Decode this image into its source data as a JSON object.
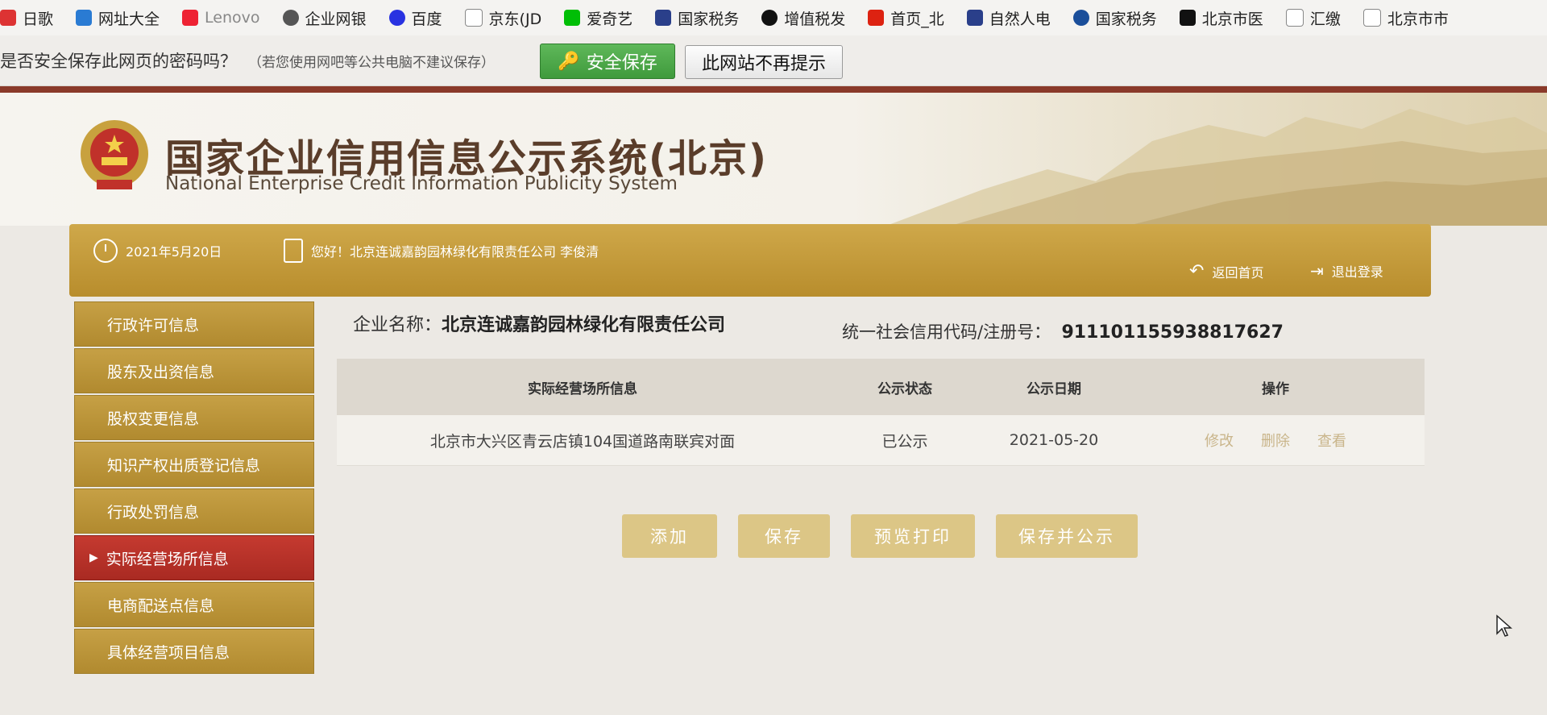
{
  "bookmarks": [
    "日歌",
    "网址大全",
    "Lenovo",
    "企业网银",
    "百度",
    "京东(JD",
    "爱奇艺",
    "国家税务",
    "增值税发",
    "首页_北",
    "自然人电",
    "国家税务",
    "北京市医",
    "汇缴",
    "北京市市"
  ],
  "infobar": {
    "message": "是否安全保存此网页的密码吗？",
    "note": "（若您使用网吧等公共电脑不建议保存）",
    "save_button": "安全保存",
    "never_button": "此网站不再提示"
  },
  "site": {
    "title": "国家企业信用信息公示系统(北京)",
    "subtitle": "National Enterprise Credit Information Publicity System"
  },
  "userbar": {
    "date": "2021年5月20日",
    "greeting": "您好！北京连诚嘉韵园林绿化有限责任公司  李俊清",
    "home": "返回首页",
    "logout": "退出登录"
  },
  "sidebar": {
    "items": [
      {
        "label": "行政许可信息"
      },
      {
        "label": "股东及出资信息"
      },
      {
        "label": "股权变更信息"
      },
      {
        "label": "知识产权出质登记信息"
      },
      {
        "label": "行政处罚信息"
      },
      {
        "label": "实际经营场所信息",
        "active": true
      },
      {
        "label": "电商配送点信息"
      },
      {
        "label": "具体经营项目信息"
      }
    ]
  },
  "company": {
    "name_label": "企业名称：",
    "name": "北京连诚嘉韵园林绿化有限责任公司",
    "code_label": "统一社会信用代码/注册号：",
    "code": "911101155938817627"
  },
  "table": {
    "headers": [
      "实际经营场所信息",
      "公示状态",
      "公示日期",
      "操作"
    ],
    "rows": [
      {
        "address": "北京市大兴区青云店镇104国道路南联宾对面",
        "status": "已公示",
        "date": "2021-05-20",
        "edit": "修改",
        "delete": "删除",
        "view": "查看"
      }
    ]
  },
  "actions": {
    "add": "添加",
    "save": "保存",
    "preview": "预览打印",
    "save_publish": "保存并公示"
  },
  "colors": {
    "gold": "#c29a3c",
    "active_red": "#b5302a",
    "button_gold": "#dcc686",
    "green_button": "#4aa845"
  }
}
